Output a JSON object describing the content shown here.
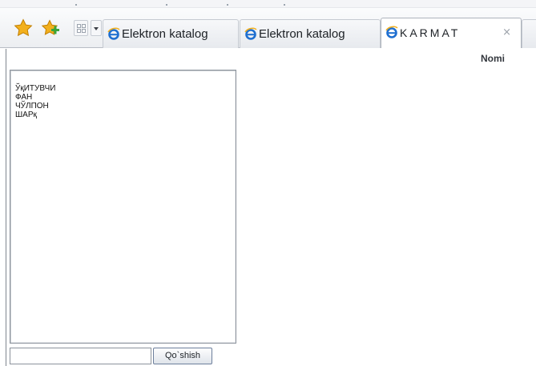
{
  "browser": {
    "tabs": [
      {
        "label": "Elektron katalog",
        "active": false,
        "icon": "ie-icon"
      },
      {
        "label": "Elektron katalog",
        "active": false,
        "icon": "ie-icon"
      },
      {
        "label": "KARMAT",
        "active": true,
        "icon": "ie-icon"
      }
    ],
    "close_glyph": "×",
    "toolbar_icons": [
      "favorites-star-icon",
      "add-favorites-icon",
      "quick-tabs-icon",
      "tab-list-icon"
    ]
  },
  "page": {
    "column_header": "Nomi",
    "list_items": [
      "ЎқИТУВЧИ",
      "ФАН",
      "ЧЎЛПОН",
      "ШАРқ"
    ],
    "add_input_value": "",
    "add_button_label": "Qo`shish"
  },
  "colors": {
    "star": "#f2b01e",
    "ie_blue": "#1f6fd0",
    "add_plus": "#3aa63a"
  }
}
